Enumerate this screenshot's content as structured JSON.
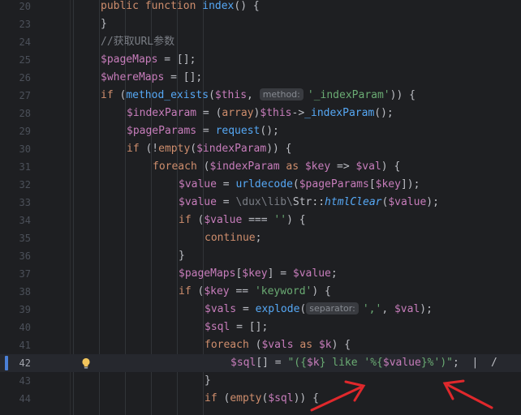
{
  "editor": {
    "current_line": "42",
    "lines": [
      {
        "n": "20",
        "indent": 0,
        "tokens": [
          [
            "kw",
            "public "
          ],
          [
            "kw",
            "function "
          ],
          [
            "fn",
            "index"
          ],
          [
            "",
            "() {"
          ]
        ]
      },
      {
        "n": "23",
        "indent": 1,
        "tokens": [
          [
            "",
            "}"
          ]
        ]
      },
      {
        "n": "24",
        "indent": 1,
        "tokens": [
          [
            "cmt",
            "//获取URL参数"
          ]
        ]
      },
      {
        "n": "25",
        "indent": 1,
        "tokens": [
          [
            "var",
            "$pageMaps"
          ],
          [
            "",
            " = [];"
          ]
        ]
      },
      {
        "n": "26",
        "indent": 1,
        "tokens": [
          [
            "var",
            "$whereMaps"
          ],
          [
            "",
            " = [];"
          ]
        ]
      },
      {
        "n": "27",
        "indent": 1,
        "tokens": [
          [
            "kw",
            "if "
          ],
          [
            "",
            "("
          ],
          [
            "fn",
            "method_exists"
          ],
          [
            "",
            "("
          ],
          [
            "var",
            "$this"
          ],
          [
            "",
            ", "
          ],
          [
            "hint",
            "method:"
          ],
          [
            "str",
            "'_indexParam'"
          ],
          [
            "",
            "))"
          ],
          [
            "",
            " {"
          ]
        ]
      },
      {
        "n": "28",
        "indent": 2,
        "tokens": [
          [
            "var",
            "$indexParam"
          ],
          [
            "",
            " = ("
          ],
          [
            "kw",
            "array"
          ],
          [
            ")",
            ""
          ],
          [
            "",
            ")"
          ],
          [
            "var",
            "$this"
          ],
          [
            "",
            "->"
          ],
          [
            "fn",
            "_indexParam"
          ],
          [
            "",
            "();"
          ]
        ]
      },
      {
        "n": "29",
        "indent": 2,
        "tokens": [
          [
            "var",
            "$pageParams"
          ],
          [
            "",
            " = "
          ],
          [
            "fn",
            "request"
          ],
          [
            "",
            "();"
          ]
        ]
      },
      {
        "n": "30",
        "indent": 2,
        "tokens": [
          [
            "kw",
            "if "
          ],
          [
            "",
            "(!"
          ],
          [
            "kw",
            "empty"
          ],
          [
            "",
            "("
          ],
          [
            "var",
            "$indexParam"
          ],
          [
            "",
            ")) {"
          ]
        ]
      },
      {
        "n": "31",
        "indent": 3,
        "tokens": [
          [
            "kw",
            "foreach "
          ],
          [
            "",
            "("
          ],
          [
            "var",
            "$indexParam"
          ],
          [
            "kw",
            " as "
          ],
          [
            "var",
            "$key"
          ],
          [
            "",
            " => "
          ],
          [
            "var",
            "$val"
          ],
          [
            "",
            ") {"
          ]
        ]
      },
      {
        "n": "32",
        "indent": 4,
        "tokens": [
          [
            "var",
            "$value"
          ],
          [
            "",
            " = "
          ],
          [
            "fn",
            "urldecode"
          ],
          [
            "",
            "("
          ],
          [
            "var",
            "$pageParams"
          ],
          [
            "",
            "["
          ],
          [
            "var",
            "$key"
          ],
          [
            "",
            "]);"
          ]
        ]
      },
      {
        "n": "33",
        "indent": 4,
        "tokens": [
          [
            "var",
            "$value"
          ],
          [
            "",
            " = "
          ],
          [
            "ns",
            "\\dux\\lib\\"
          ],
          [
            "",
            "Str::"
          ],
          [
            "ital",
            "htmlClear"
          ],
          [
            "",
            "("
          ],
          [
            "var",
            "$value"
          ],
          [
            "",
            ");"
          ]
        ]
      },
      {
        "n": "34",
        "indent": 4,
        "tokens": [
          [
            "kw",
            "if "
          ],
          [
            "",
            "("
          ],
          [
            "var",
            "$value"
          ],
          [
            "",
            " === "
          ],
          [
            "str",
            "''"
          ],
          [
            "",
            ") {"
          ]
        ]
      },
      {
        "n": "35",
        "indent": 5,
        "tokens": [
          [
            "kw",
            "continue"
          ],
          [
            "",
            ";"
          ]
        ]
      },
      {
        "n": "36",
        "indent": 4,
        "tokens": [
          [
            "",
            "}"
          ]
        ]
      },
      {
        "n": "37",
        "indent": 4,
        "tokens": [
          [
            "var",
            "$pageMaps"
          ],
          [
            "",
            "["
          ],
          [
            "var",
            "$key"
          ],
          [
            "",
            "] = "
          ],
          [
            "var",
            "$value"
          ],
          [
            "",
            ";"
          ]
        ]
      },
      {
        "n": "38",
        "indent": 4,
        "tokens": [
          [
            "kw",
            "if "
          ],
          [
            "",
            "("
          ],
          [
            "var",
            "$key"
          ],
          [
            "",
            " == "
          ],
          [
            "str",
            "'keyword'"
          ],
          [
            "",
            ") {"
          ]
        ]
      },
      {
        "n": "39",
        "indent": 5,
        "tokens": [
          [
            "var",
            "$vals"
          ],
          [
            "",
            " = "
          ],
          [
            "fn",
            "explode"
          ],
          [
            "",
            "("
          ],
          [
            "hint",
            "separator:"
          ],
          [
            "str",
            "','"
          ],
          [
            "",
            ", "
          ],
          [
            "var",
            "$val"
          ],
          [
            "",
            ");"
          ]
        ]
      },
      {
        "n": "40",
        "indent": 5,
        "tokens": [
          [
            "var",
            "$sql"
          ],
          [
            "",
            " = [];"
          ]
        ]
      },
      {
        "n": "41",
        "indent": 5,
        "tokens": [
          [
            "kw",
            "foreach "
          ],
          [
            "",
            "("
          ],
          [
            "var",
            "$vals"
          ],
          [
            "kw",
            " as "
          ],
          [
            "var",
            "$k"
          ],
          [
            "",
            ") {"
          ]
        ]
      },
      {
        "n": "42",
        "indent": 6,
        "tokens": [
          [
            "var",
            "$sql"
          ],
          [
            "",
            "[] = "
          ],
          [
            "str",
            "\"({"
          ],
          [
            "var",
            "$k"
          ],
          [
            "str",
            "} like '%{"
          ],
          [
            "var",
            "$value"
          ],
          [
            "str",
            "}%')\""
          ],
          [
            "",
            ";  |  /"
          ]
        ]
      },
      {
        "n": "43",
        "indent": 5,
        "tokens": [
          [
            "",
            "}"
          ]
        ]
      },
      {
        "n": "44",
        "indent": 5,
        "tokens": [
          [
            "kw",
            "if "
          ],
          [
            "",
            "("
          ],
          [
            "kw",
            "empty"
          ],
          [
            "",
            "("
          ],
          [
            "var",
            "$sql"
          ],
          [
            "",
            ")) {"
          ]
        ]
      }
    ]
  },
  "colors": {
    "background": "#1e1f22",
    "annotation_arrow": "#e0282c",
    "current_line_marker": "#4a7fd6"
  },
  "icons": {
    "intention": "lightbulb-icon"
  }
}
